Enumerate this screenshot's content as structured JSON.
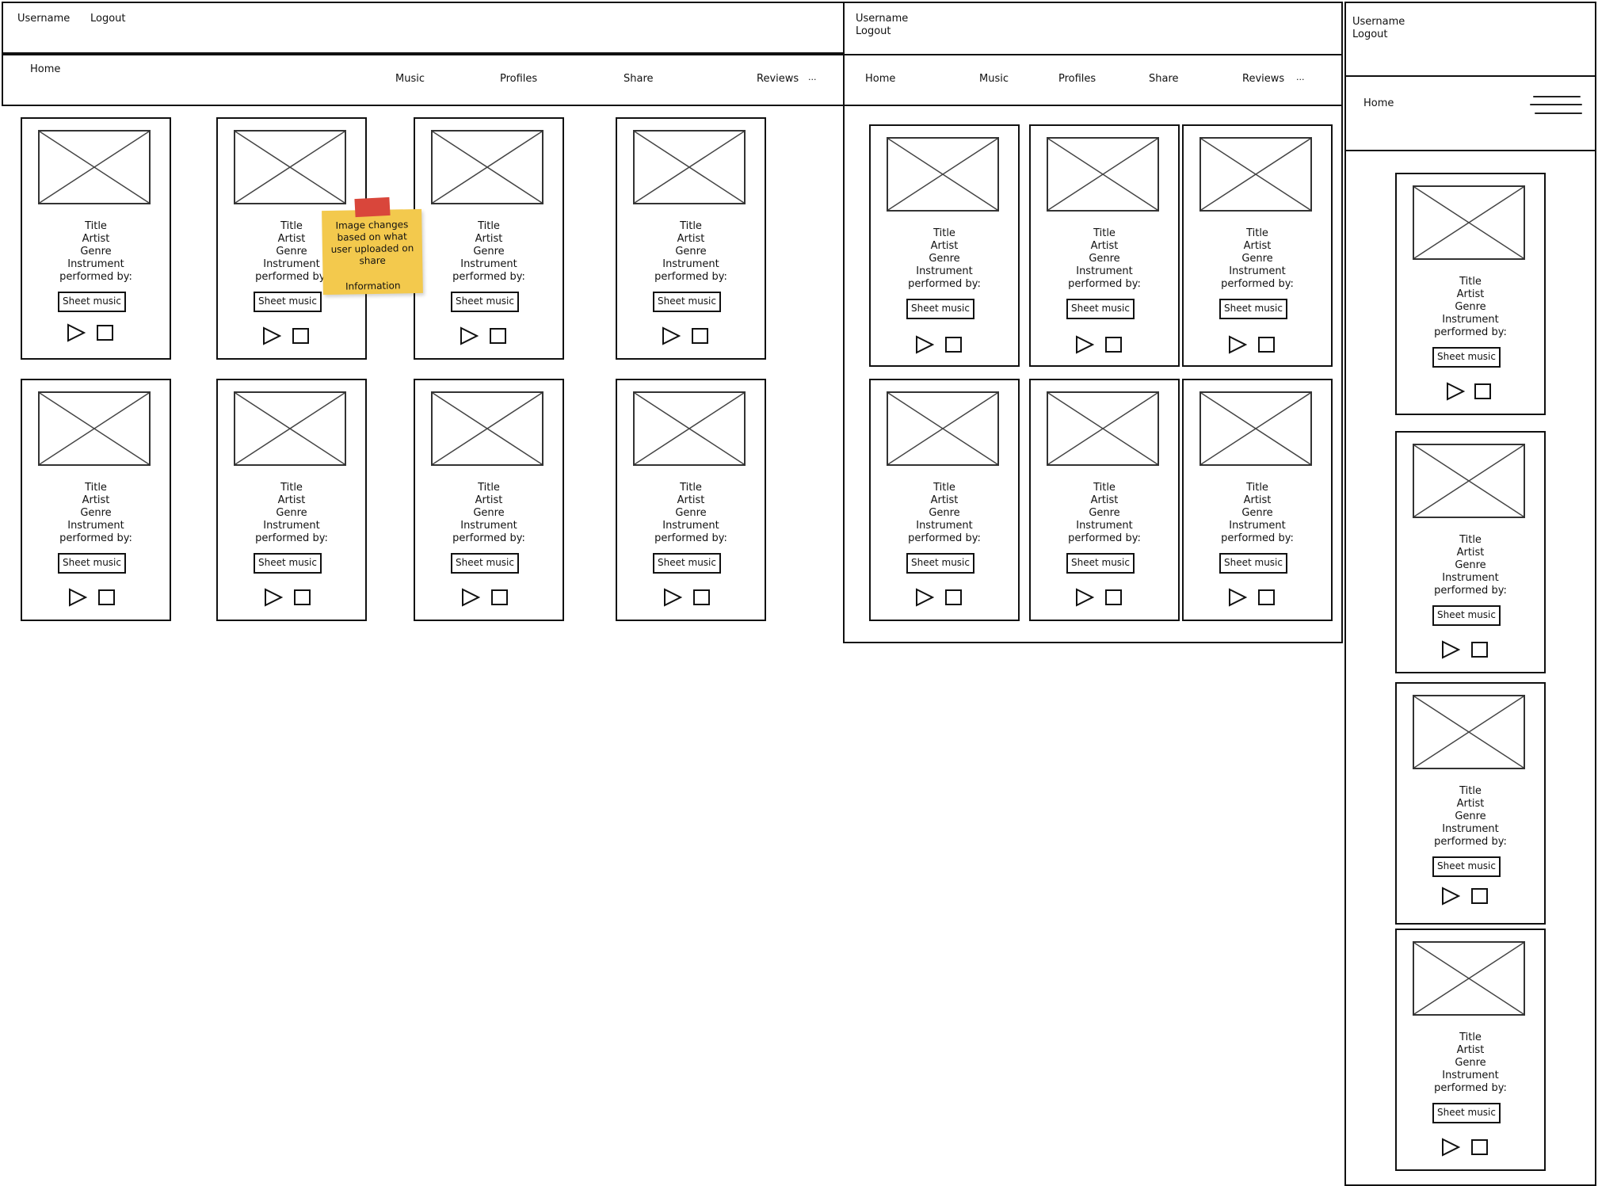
{
  "desktop": {
    "header": {
      "username": "Username",
      "logout": "Logout"
    },
    "nav": {
      "home": "Home",
      "music": "Music",
      "profiles": "Profiles",
      "share": "Share",
      "reviews": "Reviews",
      "more": "..."
    },
    "note": {
      "text_lines": [
        "Image changes",
        "based on what",
        "user uploaded on",
        "share"
      ],
      "label": "Information"
    }
  },
  "tablet": {
    "header": {
      "username": "Username",
      "logout": "Logout"
    },
    "nav": {
      "home": "Home",
      "music": "Music",
      "profiles": "Profiles",
      "share": "Share",
      "reviews": "Reviews",
      "more": "..."
    }
  },
  "mobile": {
    "header": {
      "username": "Username",
      "logout": "Logout"
    },
    "nav": {
      "home": "Home"
    }
  },
  "card": {
    "title": "Title",
    "artist": "Artist",
    "genre": "Genre",
    "instrument": "Instrument",
    "performed_by": "performed by:",
    "sheet_music": "Sheet music"
  },
  "colors": {
    "note": "#f3c94d",
    "tape": "#d9463b",
    "stroke": "#111111"
  },
  "icons": {
    "play": "play-icon",
    "stop": "stop-icon",
    "menu": "hamburger-menu-icon",
    "placeholder": "image-placeholder-icon"
  }
}
